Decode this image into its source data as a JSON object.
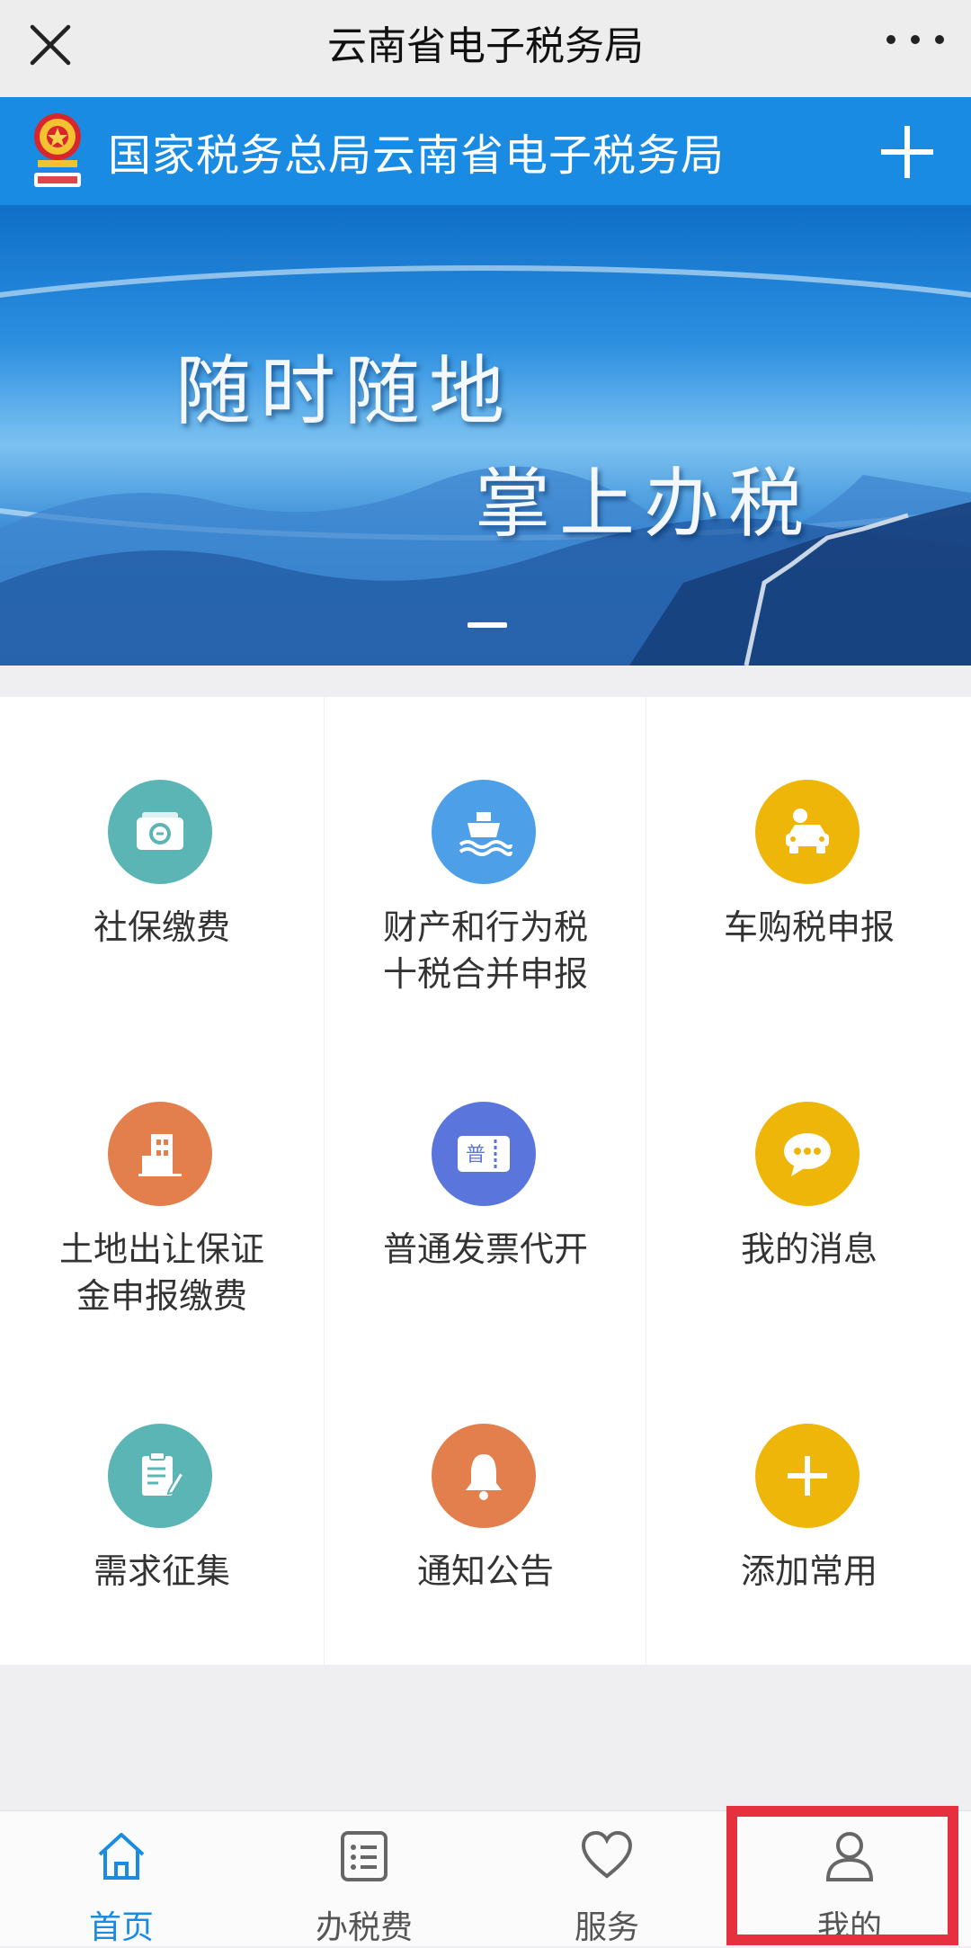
{
  "topbar": {
    "title": "云南省电子税务局"
  },
  "header": {
    "title": "国家税务总局云南省电子税务局"
  },
  "banner": {
    "slogan_line1": "随时随地",
    "slogan_line2": "掌上办税"
  },
  "grid": {
    "items": [
      {
        "label": "社保缴费",
        "icon": "social-security-card-icon",
        "color": "#5bb5b5"
      },
      {
        "label": "财产和行为税\n十税合并申报",
        "icon": "ship-icon",
        "color": "#4d9fe8"
      },
      {
        "label": "车购税申报",
        "icon": "car-icon",
        "color": "#efb60a"
      },
      {
        "label": "土地出让保证\n金申报缴费",
        "icon": "building-icon",
        "color": "#e37f4d"
      },
      {
        "label": "普通发票代开",
        "icon": "invoice-ticket-icon",
        "color": "#5a76dc"
      },
      {
        "label": "我的消息",
        "icon": "message-bubble-icon",
        "color": "#efb60a"
      },
      {
        "label": "需求征集",
        "icon": "clipboard-pen-icon",
        "color": "#5bb5b5"
      },
      {
        "label": "通知公告",
        "icon": "bell-icon",
        "color": "#e37f4d"
      },
      {
        "label": "添加常用",
        "icon": "plus-icon",
        "color": "#efb60a"
      }
    ],
    "invoice_glyph": "普"
  },
  "bottomnav": {
    "items": [
      {
        "label": "首页",
        "icon": "home-icon",
        "active": true
      },
      {
        "label": "办税费",
        "icon": "list-icon",
        "active": false
      },
      {
        "label": "服务",
        "icon": "heart-icon",
        "active": false
      },
      {
        "label": "我的",
        "icon": "user-icon",
        "active": false
      }
    ],
    "active_color": "#1a8be3"
  },
  "colors": {
    "header_blue": "#1a8be3",
    "highlight_red": "#e6303f"
  }
}
